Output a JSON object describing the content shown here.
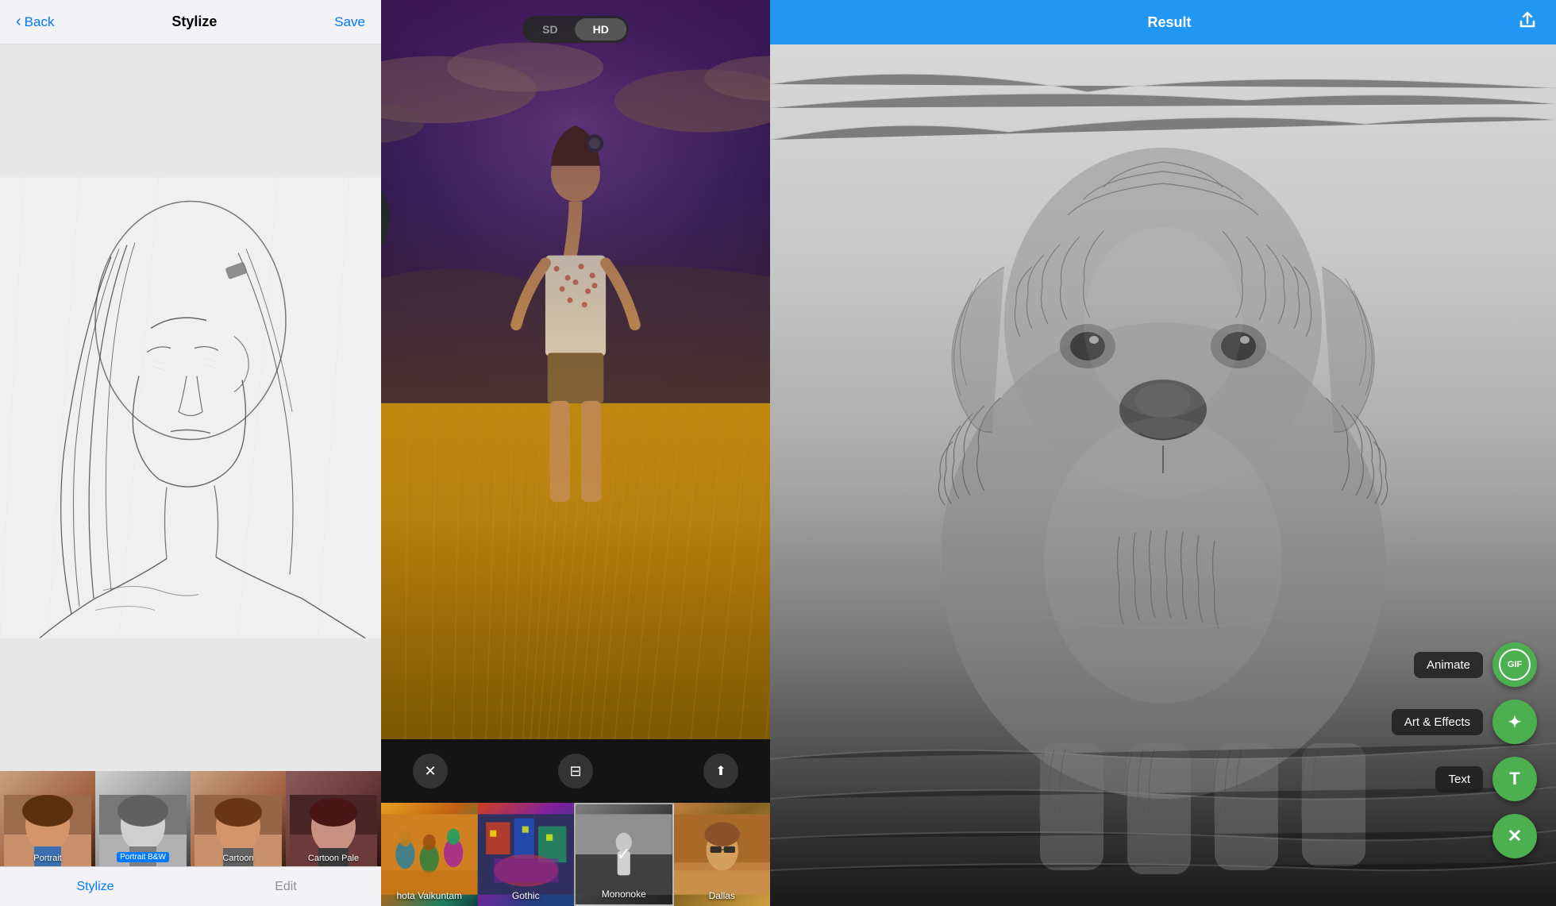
{
  "panel1": {
    "back_label": "Back",
    "title": "Stylize",
    "save_label": "Save",
    "filters": [
      {
        "id": "portrait",
        "label": "Portrait",
        "badge": null,
        "style": "portrait-bg-1"
      },
      {
        "id": "portrait-bw",
        "label": "Portrait B&W",
        "badge": "badge",
        "style": "portrait-bg-2"
      },
      {
        "id": "cartoon",
        "label": "Cartoon",
        "badge": null,
        "style": "portrait-bg-3"
      },
      {
        "id": "cartoon-pale",
        "label": "Cartoon Pale",
        "badge": null,
        "style": "portrait-bg-4"
      }
    ],
    "tabs": [
      {
        "id": "stylize",
        "label": "Stylize",
        "active": true
      },
      {
        "id": "edit",
        "label": "Edit",
        "active": false
      }
    ]
  },
  "panel2": {
    "quality_options": [
      {
        "id": "sd",
        "label": "SD",
        "active": false
      },
      {
        "id": "hd",
        "label": "HD",
        "active": true
      }
    ],
    "controls": [
      {
        "id": "close",
        "icon": "✕"
      },
      {
        "id": "adjust",
        "icon": "⊟"
      },
      {
        "id": "share",
        "icon": "↑"
      }
    ],
    "filter_strip": [
      {
        "id": "vaikuntam",
        "label": "hota Vaikuntam",
        "style": "fsi-bg-1"
      },
      {
        "id": "gothic",
        "label": "Gothic",
        "style": "fsi-bg-2"
      },
      {
        "id": "mononoke",
        "label": "Mononoke",
        "style": "fsi-bg-3",
        "selected": true
      },
      {
        "id": "dallas",
        "label": "Dallas",
        "style": "fsi-bg-4"
      }
    ]
  },
  "panel3": {
    "title": "Result",
    "share_icon": "↑",
    "fab_buttons": [
      {
        "id": "animate",
        "label": "Animate",
        "icon": "GIF"
      },
      {
        "id": "art-effects",
        "label": "Art & Effects",
        "icon": "✦"
      },
      {
        "id": "text",
        "label": "Text",
        "icon": "T"
      },
      {
        "id": "close",
        "label": null,
        "icon": "✕"
      }
    ]
  }
}
